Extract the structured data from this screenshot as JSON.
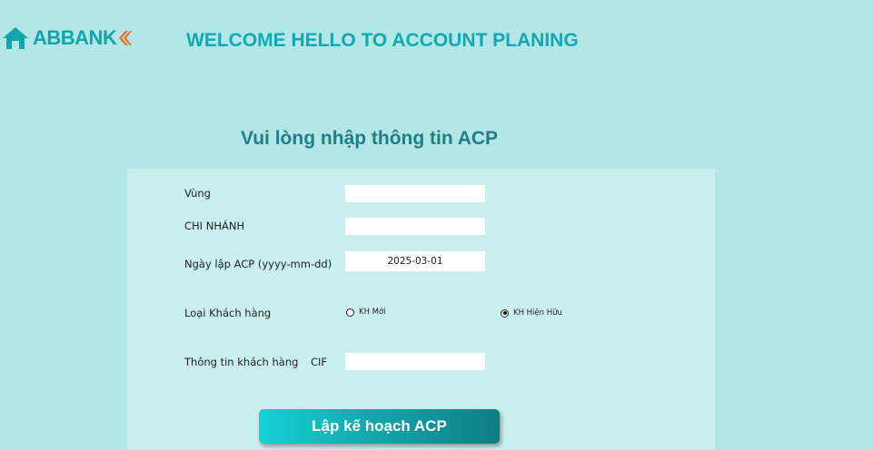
{
  "header": {
    "logo_text": "ABBANK",
    "welcome": "WELCOME HELLO TO ACCOUNT PLANING"
  },
  "form": {
    "title": "Vui lòng nhập thông tin ACP",
    "region_label": "Vùng",
    "region_value": "",
    "branch_label": "CHI NHÁNH",
    "branch_value": "",
    "date_label": "Ngày lập ACP (yyyy-mm-dd)",
    "date_value": "2025-03-01",
    "customer_type_label": "Loại Khách hàng",
    "customer_type_options": [
      {
        "label": "KH Mới",
        "checked": false
      },
      {
        "label": "KH Hiện Hữu",
        "checked": true
      }
    ],
    "customer_info_label": "Thông tin khách hàng",
    "cif_label": "CIF",
    "cif_value": "",
    "submit_label": "Lập kế hoạch ACP"
  },
  "colors": {
    "background": "#b2e6e7",
    "panel": "#c9f0ef",
    "brand_teal": "#0fa7a9",
    "brand_orange": "#f26b21",
    "title": "#1f7e86"
  }
}
